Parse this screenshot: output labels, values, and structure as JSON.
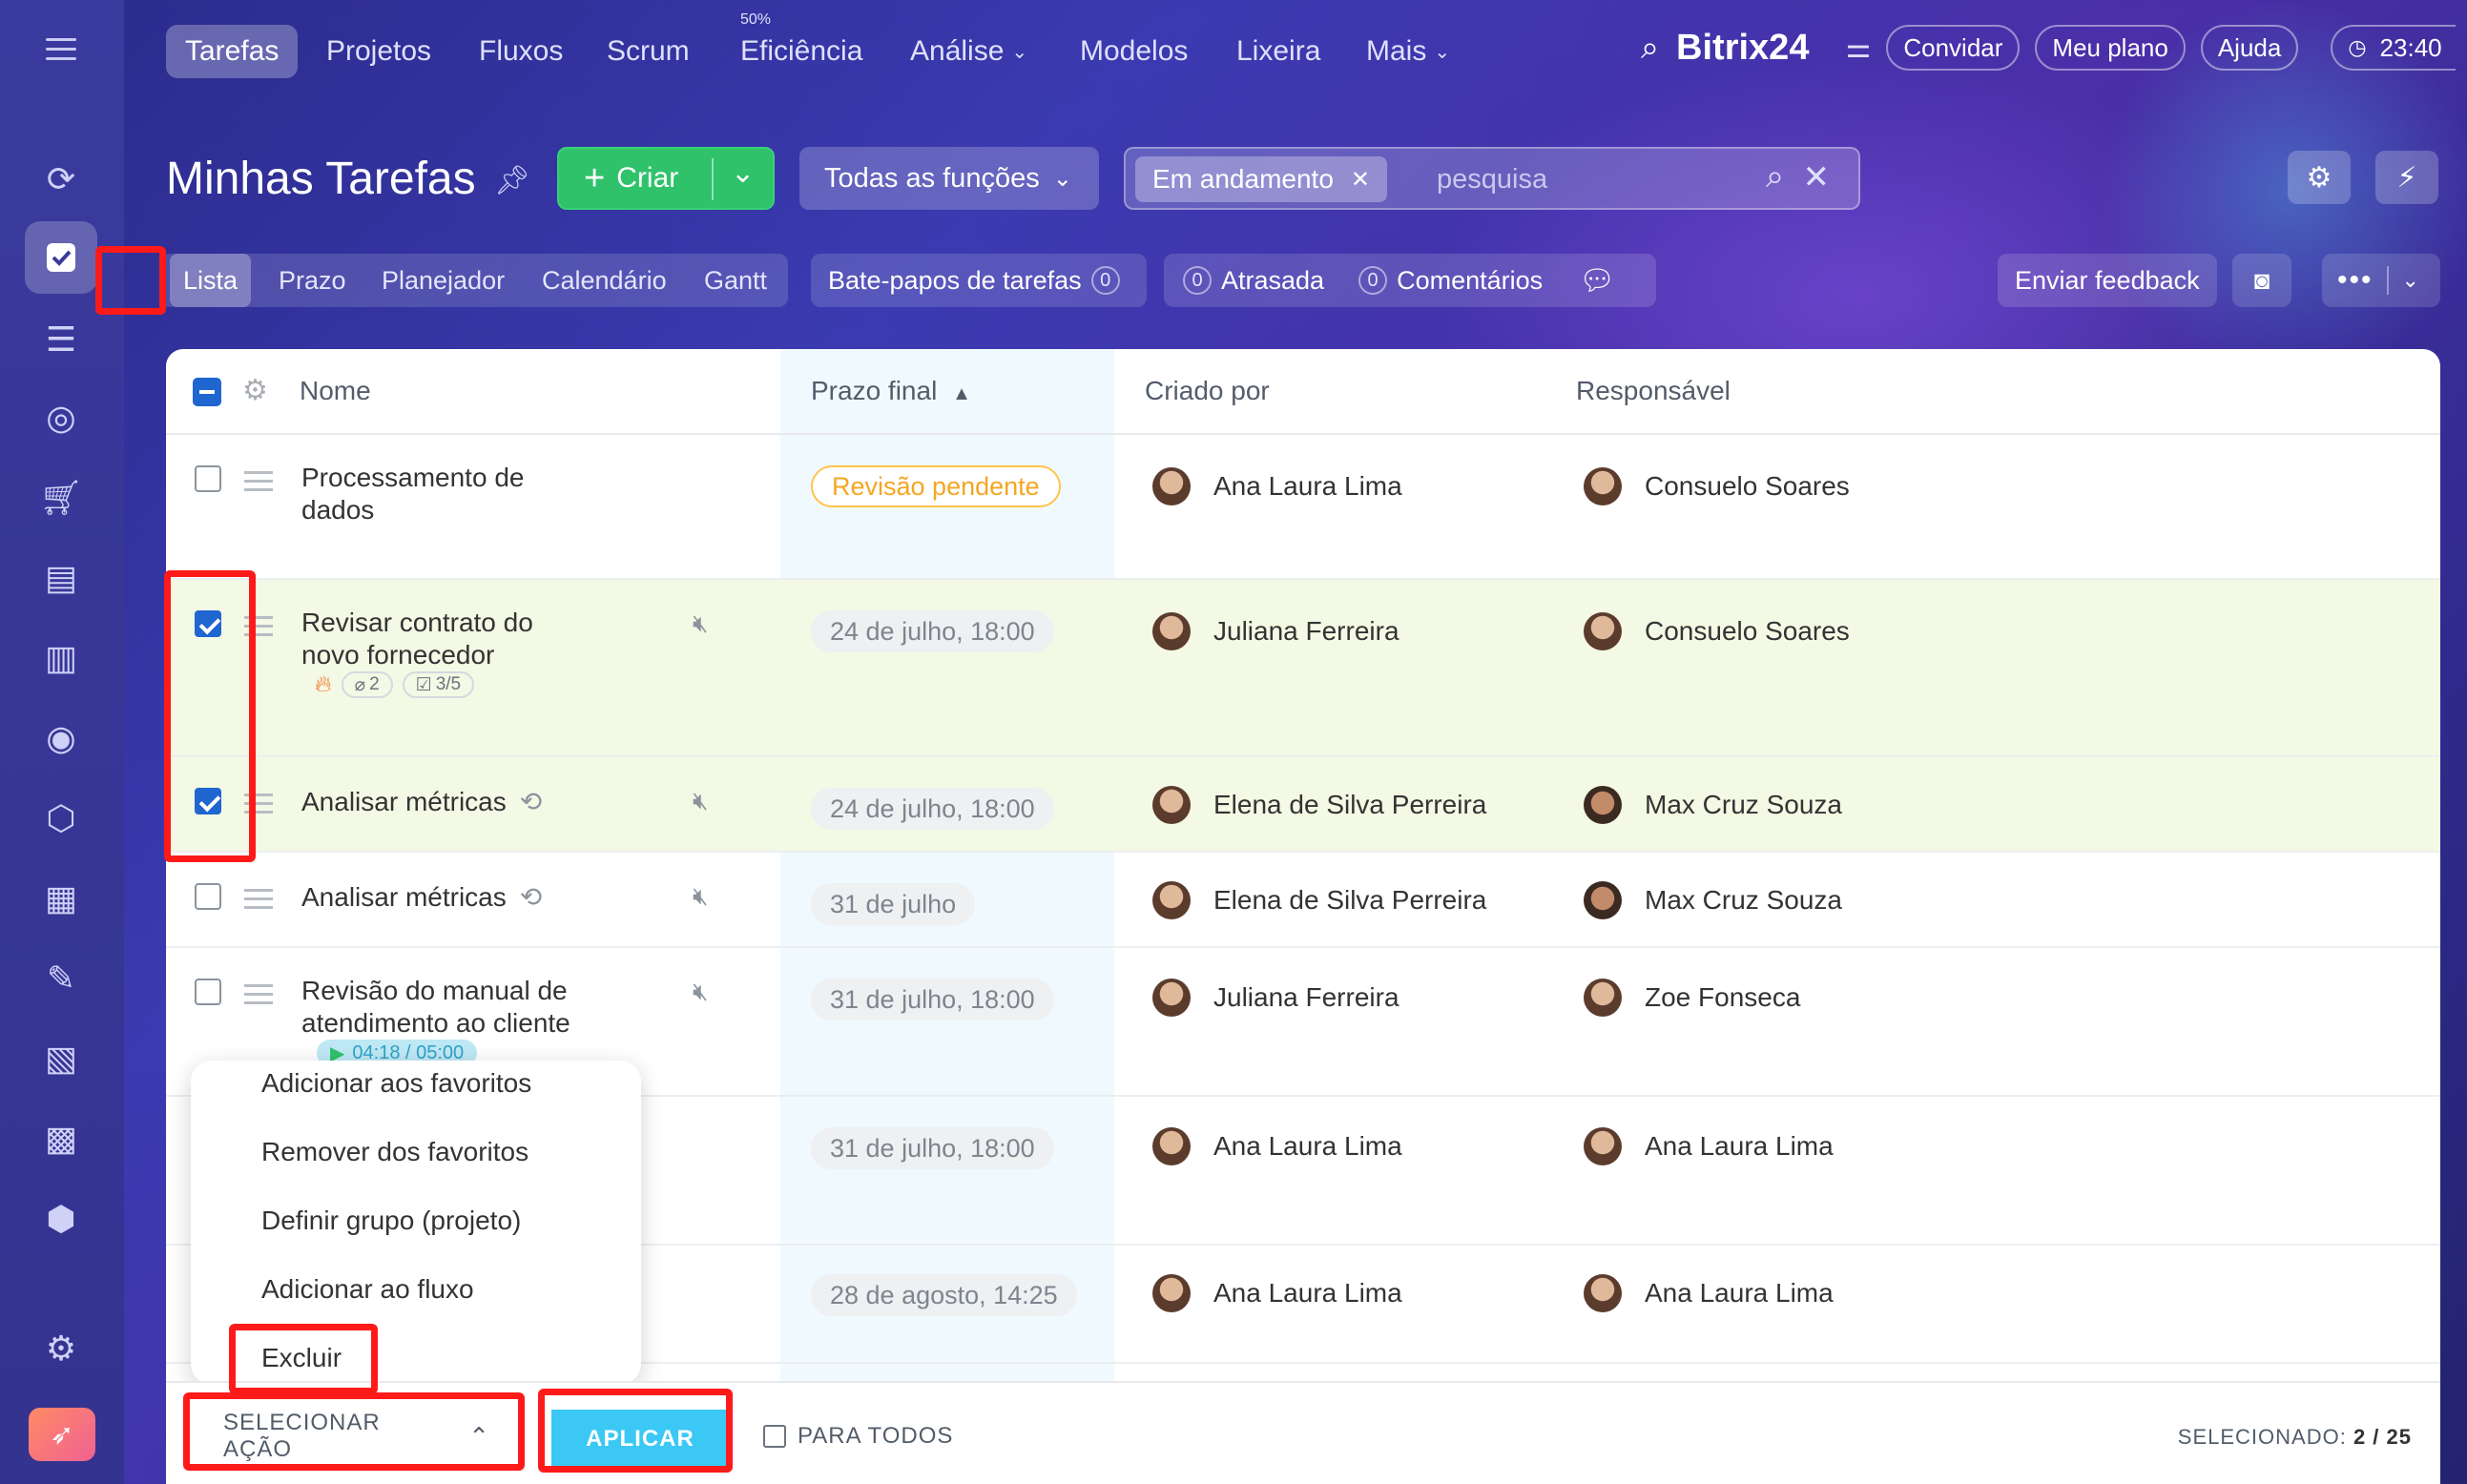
{
  "topnav": {
    "tabs": [
      "Tarefas",
      "Projetos",
      "Fluxos",
      "Scrum",
      "Eficiência",
      "Análise",
      "Modelos",
      "Lixeira",
      "Mais"
    ],
    "efficiency_badge": "50%",
    "brand": "Bitrix24",
    "invite": "Convidar",
    "my_plan": "Meu plano",
    "help": "Ajuda",
    "clock": "23:40"
  },
  "header": {
    "title": "Minhas Tarefas",
    "create_label": "Criar",
    "roles_label": "Todas as funções",
    "filter_chip": "Em andamento",
    "search_placeholder": "pesquisa"
  },
  "views": {
    "tabs": [
      "Lista",
      "Prazo",
      "Planejador",
      "Calendário",
      "Gantt"
    ],
    "chats_label": "Bate-papos de tarefas",
    "chats_count": "0",
    "overdue_count": "0",
    "overdue_label": "Atrasada",
    "comments_count": "0",
    "comments_label": "Comentários",
    "feedback_label": "Enviar feedback"
  },
  "table": {
    "columns": [
      "Nome",
      "Prazo final",
      "Criado por",
      "Responsável"
    ],
    "rows": [
      {
        "name": "Processamento de dados",
        "deadline": "Revisão pendente",
        "creator": "Ana Laura Lima",
        "responsible": "Consuelo Soares",
        "selected": false
      },
      {
        "name": "Revisar contrato do novo fornecedor",
        "deadline": "24 de julho, 18:00",
        "creator": "Juliana Ferreira",
        "responsible": "Consuelo Soares",
        "selected": true,
        "attachments": "2",
        "checklist": "3/5"
      },
      {
        "name": "Analisar métricas",
        "deadline": "24 de julho, 18:00",
        "creator": "Elena de Silva Perreira",
        "responsible": "Max Cruz Souza",
        "selected": true
      },
      {
        "name": "Analisar métricas",
        "deadline": "31 de julho",
        "creator": "Elena de Silva Perreira",
        "responsible": "Max Cruz Souza",
        "selected": false
      },
      {
        "name": "Revisão do manual de atendimento ao cliente",
        "deadline": "31 de julho, 18:00",
        "creator": "Juliana Ferreira",
        "responsible": "Zoe Fonseca",
        "selected": false,
        "timer": "04:18 / 05:00"
      },
      {
        "name": "",
        "deadline": "31 de julho, 18:00",
        "creator": "Ana Laura Lima",
        "responsible": "Ana Laura Lima",
        "selected": false
      },
      {
        "name": "",
        "deadline": "28 de agosto, 14:25",
        "creator": "Ana Laura Lima",
        "responsible": "Ana Laura Lima",
        "selected": false
      }
    ]
  },
  "action_menu": {
    "items": [
      "Adicionar aos favoritos",
      "Remover dos favoritos",
      "Definir grupo (projeto)",
      "Adicionar ao fluxo",
      "Excluir"
    ]
  },
  "action_bar": {
    "select_action": "SELECIONAR AÇÃO",
    "apply": "APLICAR",
    "for_all": "PARA TODOS",
    "selected_label": "SELECIONADO:",
    "selected_value": "2 / 25"
  },
  "colors": {
    "accent_blue": "#2066d0",
    "create_green": "#2fc26b",
    "apply_cyan": "#3bc8f5",
    "highlight_red": "#ff1a1a",
    "selected_row": "#f3f9e4"
  }
}
